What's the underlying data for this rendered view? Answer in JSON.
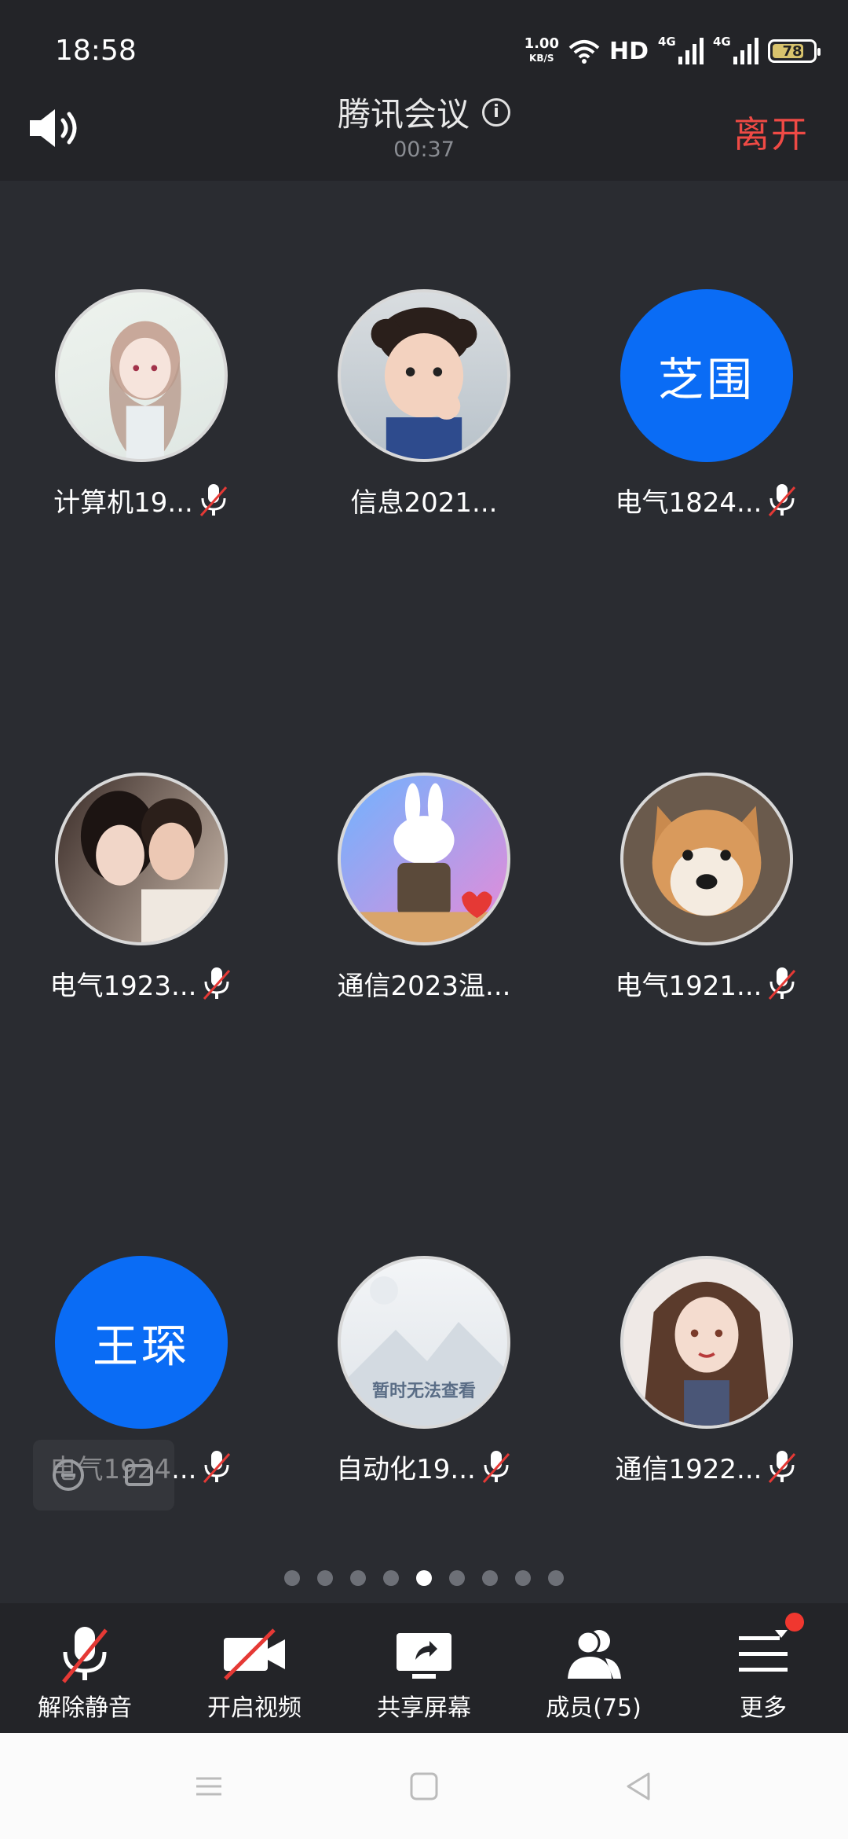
{
  "status_bar": {
    "time": "18:58",
    "net_speed_value": "1.00",
    "net_speed_unit": "KB/S",
    "hd_label": "HD",
    "signal1_label": "4G",
    "signal2_label": "4G",
    "battery": "78"
  },
  "header": {
    "title": "腾讯会议",
    "timer": "00:37",
    "leave_label": "离开"
  },
  "participants": [
    {
      "name": "计算机19...",
      "avatar_type": "photo",
      "avatar_icon": "anime-girl-avatar",
      "muted": true
    },
    {
      "name": "信息2021...",
      "avatar_type": "photo",
      "avatar_icon": "child-avatar",
      "muted": false
    },
    {
      "name": "电气1824...",
      "avatar_type": "text",
      "avatar_text": "芝围",
      "muted": true
    },
    {
      "name": "电气1923...",
      "avatar_type": "photo",
      "avatar_icon": "couple-avatar",
      "muted": true
    },
    {
      "name": "通信2023温...",
      "avatar_type": "photo",
      "avatar_icon": "rabbit-avatar",
      "muted": false
    },
    {
      "name": "电气1921...",
      "avatar_type": "photo",
      "avatar_icon": "dog-avatar",
      "muted": true
    },
    {
      "name": "电气1924...",
      "avatar_type": "text",
      "avatar_text": "王琛",
      "muted": true
    },
    {
      "name": "自动化19...",
      "avatar_type": "photo",
      "avatar_icon": "placeholder-avatar",
      "avatar_caption": "暂时无法查看",
      "muted": true
    },
    {
      "name": "通信1922...",
      "avatar_type": "photo",
      "avatar_icon": "anime-woman-avatar",
      "muted": true
    }
  ],
  "pager": {
    "total": 9,
    "active": 5
  },
  "bottom_bar": {
    "unmute": "解除静音",
    "video": "开启视频",
    "share": "共享屏幕",
    "members": "成员(75)",
    "more": "更多"
  },
  "colors": {
    "accent_blue": "#0a6cf5",
    "leave_red": "#ef4a45",
    "background": "#2a2c31"
  }
}
